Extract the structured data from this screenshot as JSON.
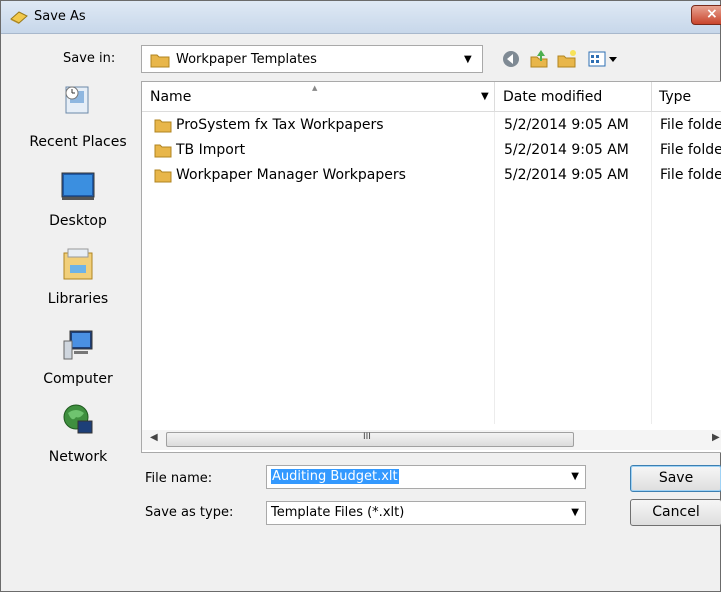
{
  "window": {
    "title": "Save As",
    "close_glyph": "×"
  },
  "location": {
    "label": "Save in:",
    "current_folder": "Workpaper Templates"
  },
  "toolbar": {
    "icons": [
      "back-icon",
      "up-folder-icon",
      "new-folder-icon",
      "view-menu-icon"
    ]
  },
  "places": [
    {
      "label": "Recent Places",
      "icon": "recent-places-icon"
    },
    {
      "label": "Desktop",
      "icon": "desktop-icon"
    },
    {
      "label": "Libraries",
      "icon": "libraries-icon"
    },
    {
      "label": "Computer",
      "icon": "computer-icon"
    },
    {
      "label": "Network",
      "icon": "network-icon"
    }
  ],
  "file_list": {
    "columns": [
      "Name",
      "Date modified",
      "Type"
    ],
    "rows": [
      {
        "name": "ProSystem fx Tax Workpapers",
        "date": "5/2/2014 9:05 AM",
        "type": "File folder"
      },
      {
        "name": "TB Import",
        "date": "5/2/2014 9:05 AM",
        "type": "File folder"
      },
      {
        "name": "Workpaper Manager Workpapers",
        "date": "5/2/2014 9:05 AM",
        "type": "File folder"
      }
    ],
    "scroll_grip": "III"
  },
  "form": {
    "file_name_label": "File name:",
    "file_name_value": "Auditing Budget.xlt",
    "save_type_label": "Save as type:",
    "save_type_value": "Template Files (*.xlt)"
  },
  "buttons": {
    "save": "Save",
    "cancel": "Cancel"
  },
  "colors": {
    "selection": "#3399ff",
    "folder": "#e8b64a"
  }
}
